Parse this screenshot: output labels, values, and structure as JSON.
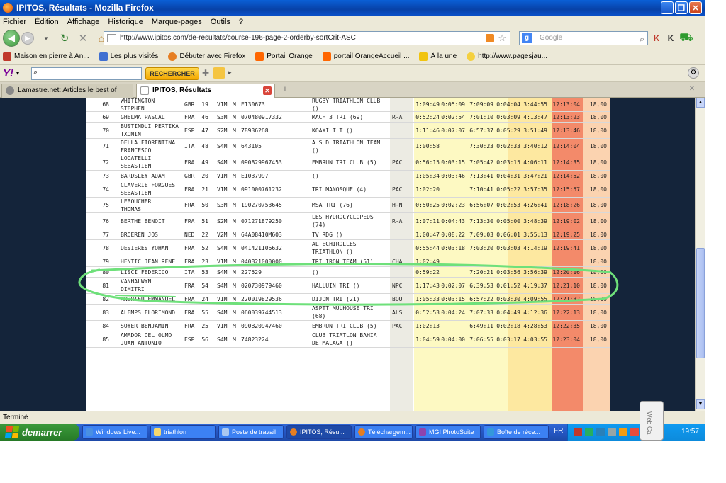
{
  "window": {
    "title": "IPITOS, Résultats - Mozilla Firefox",
    "controls": [
      "_",
      "❐",
      "✕"
    ]
  },
  "menu": [
    "Fichier",
    "Édition",
    "Affichage",
    "Historique",
    "Marque-pages",
    "Outils",
    "?"
  ],
  "nav": {
    "url": "http://www.ipitos.com/de-resultats/course-196-page-2-orderby-sortCrit-ASC",
    "search_placeholder": "Google",
    "icons": [
      "back-icon",
      "forward-icon",
      "reload-icon",
      "stop-icon",
      "home-icon"
    ]
  },
  "bookmarks": [
    {
      "label": "Maison en pierre à An...",
      "color": "#c0392b"
    },
    {
      "label": "Les plus visités",
      "color": "#3f6fd1"
    },
    {
      "label": "Débuter avec Firefox",
      "color": "#e67e22"
    },
    {
      "label": "Portail Orange",
      "color": "#ff6600"
    },
    {
      "label": "portail OrangeAccueil ...",
      "color": "#ff6600"
    },
    {
      "label": "À la une",
      "color": "#f1c40f"
    },
    {
      "label": "http://www.pagesjau...",
      "color": "#f4d03f"
    }
  ],
  "yahoo": {
    "logo": "Y!",
    "button": "RECHERCHER"
  },
  "tabs": [
    {
      "label": "Lamastre.net: Articles le best of",
      "active": false
    },
    {
      "label": "IPITOS, Résultats",
      "active": true
    }
  ],
  "results": [
    {
      "rank": "68",
      "name": "WHITINGTON\nSTEPHEN",
      "nat": "GBR",
      "num": "19",
      "cat": "V1M",
      "sex": "M",
      "lic": "E130673",
      "club": "RUGBY TRIATHLON CLUB\n()",
      "ligue": "",
      "t1": "1:09:49",
      "t2": "0:05:09",
      "t3": "7:09:09",
      "t4": "0:04:04",
      "t5": "3:44:55",
      "total": "12:13:04",
      "pts": "18,00"
    },
    {
      "rank": "69",
      "name": "GHELMA PASCAL",
      "nat": "FRA",
      "num": "46",
      "cat": "S3M",
      "sex": "M",
      "lic": "070480917332",
      "club": "MACH 3 TRI (69)",
      "ligue": "R-A",
      "t1": "0:52:24",
      "t2": "0:02:54",
      "t3": "7:01:10",
      "t4": "0:03:09",
      "t5": "4:13:47",
      "total": "12:13:23",
      "pts": "18,00"
    },
    {
      "rank": "70",
      "name": "BUSTINDUI PERTIKA\nTXOMIN",
      "nat": "ESP",
      "num": "47",
      "cat": "S2M",
      "sex": "M",
      "lic": "78936268",
      "club": "KOAXI T T ()",
      "ligue": "",
      "t1": "1:11:46",
      "t2": "0:07:07",
      "t3": "6:57:37",
      "t4": "0:05:29",
      "t5": "3:51:49",
      "total": "12:13:46",
      "pts": "18,00"
    },
    {
      "rank": "71",
      "name": "DELLA FIORENTINA\nFRANCESCO",
      "nat": "ITA",
      "num": "48",
      "cat": "S4M",
      "sex": "M",
      "lic": "643105",
      "club": "A S D TRIATHLON TEAM\n()",
      "ligue": "",
      "t1": "1:00:58",
      "t2": "",
      "t3": "7:30:23",
      "t4": "0:02:33",
      "t5": "3:40:12",
      "total": "12:14:04",
      "pts": "18,00"
    },
    {
      "rank": "72",
      "name": "LOCATELLI\nSEBASTIEN",
      "nat": "FRA",
      "num": "49",
      "cat": "S4M",
      "sex": "M",
      "lic": "090829967453",
      "club": "EMBRUN TRI CLUB (5)",
      "ligue": "PAC",
      "t1": "0:56:15",
      "t2": "0:03:15",
      "t3": "7:05:42",
      "t4": "0:03:15",
      "t5": "4:06:11",
      "total": "12:14:35",
      "pts": "18,00"
    },
    {
      "rank": "73",
      "name": "BARDSLEY ADAM",
      "nat": "GBR",
      "num": "20",
      "cat": "V1M",
      "sex": "M",
      "lic": "E1037997",
      "club": "()",
      "ligue": "",
      "t1": "1:05:34",
      "t2": "0:03:46",
      "t3": "7:13:41",
      "t4": "0:04:31",
      "t5": "3:47:21",
      "total": "12:14:52",
      "pts": "18,00"
    },
    {
      "rank": "74",
      "name": "CLAVERIE FORGUES\nSEBASTIEN",
      "nat": "FRA",
      "num": "21",
      "cat": "V1M",
      "sex": "M",
      "lic": "091000761232",
      "club": "TRI MANOSQUE (4)",
      "ligue": "PAC",
      "t1": "1:02:20",
      "t2": "",
      "t3": "7:10:41",
      "t4": "0:05:22",
      "t5": "3:57:35",
      "total": "12:15:57",
      "pts": "18,00"
    },
    {
      "rank": "75",
      "name": "LEBOUCHER\nTHOMAS",
      "nat": "FRA",
      "num": "50",
      "cat": "S3M",
      "sex": "M",
      "lic": "190270753645",
      "club": "MSA TRI (76)",
      "ligue": "H-N",
      "t1": "0:50:25",
      "t2": "0:02:23",
      "t3": "6:56:07",
      "t4": "0:02:53",
      "t5": "4:26:41",
      "total": "12:18:26",
      "pts": "18,00"
    },
    {
      "rank": "76",
      "name": "BERTHE BENOIT",
      "nat": "FRA",
      "num": "51",
      "cat": "S2M",
      "sex": "M",
      "lic": "071271879250",
      "club": "LES HYDROCYCLOPEDS\n(74)",
      "ligue": "R-A",
      "t1": "1:07:11",
      "t2": "0:04:43",
      "t3": "7:13:30",
      "t4": "0:05:00",
      "t5": "3:48:39",
      "total": "12:19:02",
      "pts": "18,00"
    },
    {
      "rank": "77",
      "name": "BROEREN JOS",
      "nat": "NED",
      "num": "22",
      "cat": "V2M",
      "sex": "M",
      "lic": "64A08410M603",
      "club": "TV RDG ()",
      "ligue": "",
      "t1": "1:00:47",
      "t2": "0:08:22",
      "t3": "7:09:03",
      "t4": "0:06:01",
      "t5": "3:55:13",
      "total": "12:19:25",
      "pts": "18,00"
    },
    {
      "rank": "78",
      "name": "DESIERES YOHAN",
      "nat": "FRA",
      "num": "52",
      "cat": "S4M",
      "sex": "M",
      "lic": "041421106632",
      "club": "AL ECHIROLLES\nTRIATHLON ()",
      "ligue": "",
      "t1": "0:55:44",
      "t2": "0:03:18",
      "t3": "7:03:20",
      "t4": "0:03:03",
      "t5": "4:14:19",
      "total": "12:19:41",
      "pts": "18,00"
    },
    {
      "rank": "79",
      "name": "HENTIC JEAN RENE",
      "nat": "FRA",
      "num": "23",
      "cat": "V1M",
      "sex": "M",
      "lic": "040821000000",
      "club": "TRI IRON TEAM (51)",
      "ligue": "CHA",
      "t1": "1:02:49",
      "t2": "",
      "t3": "",
      "t4": "",
      "t5": "",
      "total": "",
      "pts": "18,00"
    },
    {
      "rank": "80",
      "name": "LISCI FEDERICO",
      "nat": "ITA",
      "num": "53",
      "cat": "S4M",
      "sex": "M",
      "lic": "227529",
      "club": "()",
      "ligue": "",
      "t1": "0:59:22",
      "t2": "",
      "t3": "7:20:21",
      "t4": "0:03:56",
      "t5": "3:56:39",
      "total": "12:20:16",
      "pts": "18,00"
    },
    {
      "rank": "81",
      "name": "VANHALWYN\nDIMITRI",
      "nat": "FRA",
      "num": "54",
      "cat": "S4M",
      "sex": "M",
      "lic": "020730979460",
      "club": "HALLUIN TRI ()",
      "ligue": "NPC",
      "t1": "1:17:43",
      "t2": "0:02:07",
      "t3": "6:39:53",
      "t4": "0:01:52",
      "t5": "4:19:37",
      "total": "12:21:10",
      "pts": "18,00"
    },
    {
      "rank": "82",
      "name": "ANDRIEU EMMANUEL",
      "nat": "FRA",
      "num": "24",
      "cat": "V1M",
      "sex": "M",
      "lic": "220019829536",
      "club": "DIJON TRI (21)",
      "ligue": "BOU",
      "t1": "1:05:33",
      "t2": "0:03:15",
      "t3": "6:57:22",
      "t4": "0:03:30",
      "t5": "4:09:55",
      "total": "12:21:32",
      "pts": "18,00"
    },
    {
      "rank": "83",
      "name": "ALEMPS FLORIMOND",
      "nat": "FRA",
      "num": "55",
      "cat": "S4M",
      "sex": "M",
      "lic": "060039744513",
      "club": "ASPTT MULHOUSE TRI\n(68)",
      "ligue": "ALS",
      "t1": "0:52:53",
      "t2": "0:04:24",
      "t3": "7:07:33",
      "t4": "0:04:49",
      "t5": "4:12:36",
      "total": "12:22:13",
      "pts": "18,00"
    },
    {
      "rank": "84",
      "name": "SOYER BENJAMIN",
      "nat": "FRA",
      "num": "25",
      "cat": "V1M",
      "sex": "M",
      "lic": "090820947460",
      "club": "EMBRUN TRI CLUB (5)",
      "ligue": "PAC",
      "t1": "1:02:13",
      "t2": "",
      "t3": "6:49:11",
      "t4": "0:02:18",
      "t5": "4:28:53",
      "total": "12:22:35",
      "pts": "18,00"
    },
    {
      "rank": "85",
      "name": "AMADOR DEL OLMO\nJUAN ANTONIO",
      "nat": "ESP",
      "num": "56",
      "cat": "S4M",
      "sex": "M",
      "lic": "74823224",
      "club": "CLUB TRIATLON BAHIA\nDE MALAGA ()",
      "ligue": "",
      "t1": "1:04:59",
      "t2": "0:04:00",
      "t3": "7:06:55",
      "t4": "0:03:17",
      "t5": "4:03:55",
      "total": "12:23:04",
      "pts": "18,00"
    }
  ],
  "status": "Terminé",
  "taskbar": {
    "start": "demarrer",
    "tasks": [
      {
        "label": "Windows Live...",
        "color": "#4a90e2"
      },
      {
        "label": "triathlon",
        "color": "#f5d76e"
      },
      {
        "label": "Poste de travail",
        "color": "#aac8f0"
      },
      {
        "label": "IPITOS, Résu...",
        "color": "#e67e22"
      },
      {
        "label": "Téléchargem...",
        "color": "#e67e22"
      },
      {
        "label": "MGI PhotoSuite",
        "color": "#8e44ad"
      },
      {
        "label": "Boîte de réce...",
        "color": "#3498db"
      }
    ],
    "lang": "FR",
    "clock": "19:57"
  },
  "overlay": {
    "webcam_label": "Web Ca",
    "annotation_color": "#6ee07a"
  }
}
